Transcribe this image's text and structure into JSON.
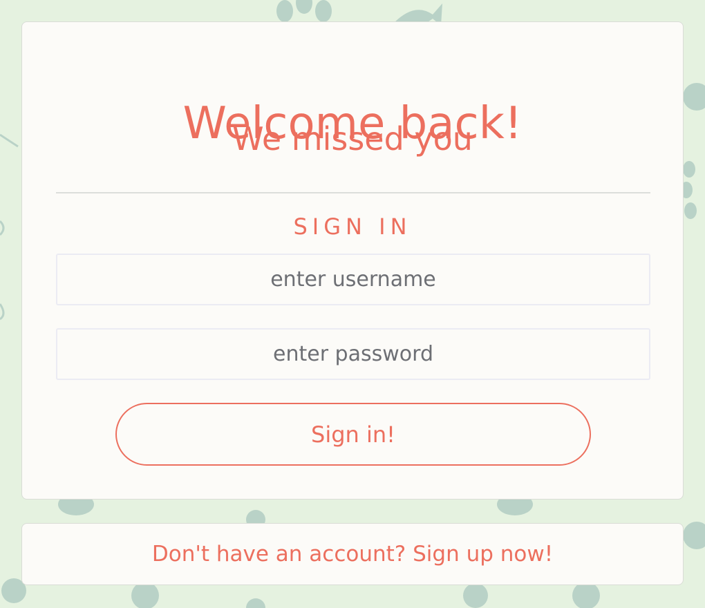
{
  "colors": {
    "background": "#e5f2e0",
    "pattern": "#b9d2c7",
    "card": "#fcfbf8",
    "accent": "#ec6f5e",
    "placeholder_text": "#6d6f74"
  },
  "background_icons": [
    "paw-icon",
    "fish-icon",
    "yarn-ball-icon",
    "fish-bowl-icon",
    "cat-toy-icon"
  ],
  "login": {
    "title": "Welcome back!",
    "subtitle": "We missed you",
    "section_heading": "SIGN IN",
    "username_placeholder": "enter username",
    "password_placeholder": "enter password",
    "submit_label": "Sign in!"
  },
  "signup": {
    "link_text": "Don't have an account? Sign up now!"
  }
}
